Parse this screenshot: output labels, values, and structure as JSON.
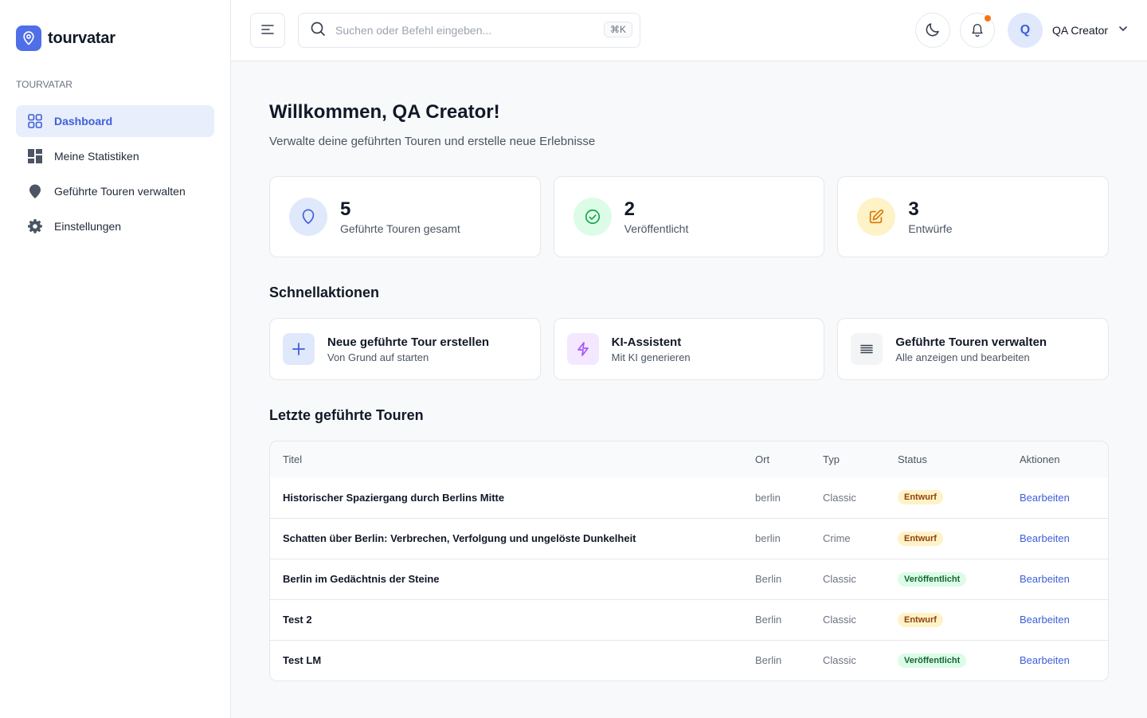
{
  "brand": {
    "name": "tourvatar"
  },
  "sidebar": {
    "section_label": "TOURVATAR",
    "items": [
      {
        "label": "Dashboard",
        "icon": "dashboard-icon",
        "active": true
      },
      {
        "label": "Meine Statistiken",
        "icon": "stats-icon",
        "active": false
      },
      {
        "label": "Geführte Touren verwalten",
        "icon": "location-pin-icon",
        "active": false
      },
      {
        "label": "Einstellungen",
        "icon": "gear-icon",
        "active": false
      }
    ]
  },
  "header": {
    "search_placeholder": "Suchen oder Befehl eingeben...",
    "shortcut": "⌘K",
    "user": {
      "initial": "Q",
      "name": "QA Creator"
    }
  },
  "main": {
    "title": "Willkommen, QA Creator!",
    "subtitle": "Verwalte deine geführten Touren und erstelle neue Erlebnisse",
    "stats": [
      {
        "value": "5",
        "label": "Geführte Touren gesamt"
      },
      {
        "value": "2",
        "label": "Veröffentlicht"
      },
      {
        "value": "3",
        "label": "Entwürfe"
      }
    ],
    "quick_actions_title": "Schnellaktionen",
    "quick_actions": [
      {
        "title": "Neue geführte Tour erstellen",
        "desc": "Von Grund auf starten"
      },
      {
        "title": "KI-Assistent",
        "desc": "Mit KI generieren"
      },
      {
        "title": "Geführte Touren verwalten",
        "desc": "Alle anzeigen und bearbeiten"
      }
    ],
    "recent_title": "Letzte geführte Touren",
    "table": {
      "headers": [
        "Titel",
        "Ort",
        "Typ",
        "Status",
        "Aktionen"
      ],
      "rows": [
        {
          "title": "Historischer Spaziergang durch Berlins Mitte",
          "place": "berlin",
          "type": "Classic",
          "status": "Entwurf",
          "action": "Bearbeiten"
        },
        {
          "title": "Schatten über Berlin: Verbrechen, Verfolgung und ungelöste Dunkelheit",
          "place": "berlin",
          "type": "Crime",
          "status": "Entwurf",
          "action": "Bearbeiten"
        },
        {
          "title": "Berlin im Gedächtnis der Steine",
          "place": "Berlin",
          "type": "Classic",
          "status": "Veröffentlicht",
          "action": "Bearbeiten"
        },
        {
          "title": "Test 2",
          "place": "Berlin",
          "type": "Classic",
          "status": "Entwurf",
          "action": "Bearbeiten"
        },
        {
          "title": "Test LM",
          "place": "Berlin",
          "type": "Classic",
          "status": "Veröffentlicht",
          "action": "Bearbeiten"
        }
      ]
    }
  },
  "colors": {
    "accent": "#4f6fe8",
    "draft_bg": "#fef3c7",
    "published_bg": "#dcfce7",
    "notification_dot": "#f97316"
  }
}
